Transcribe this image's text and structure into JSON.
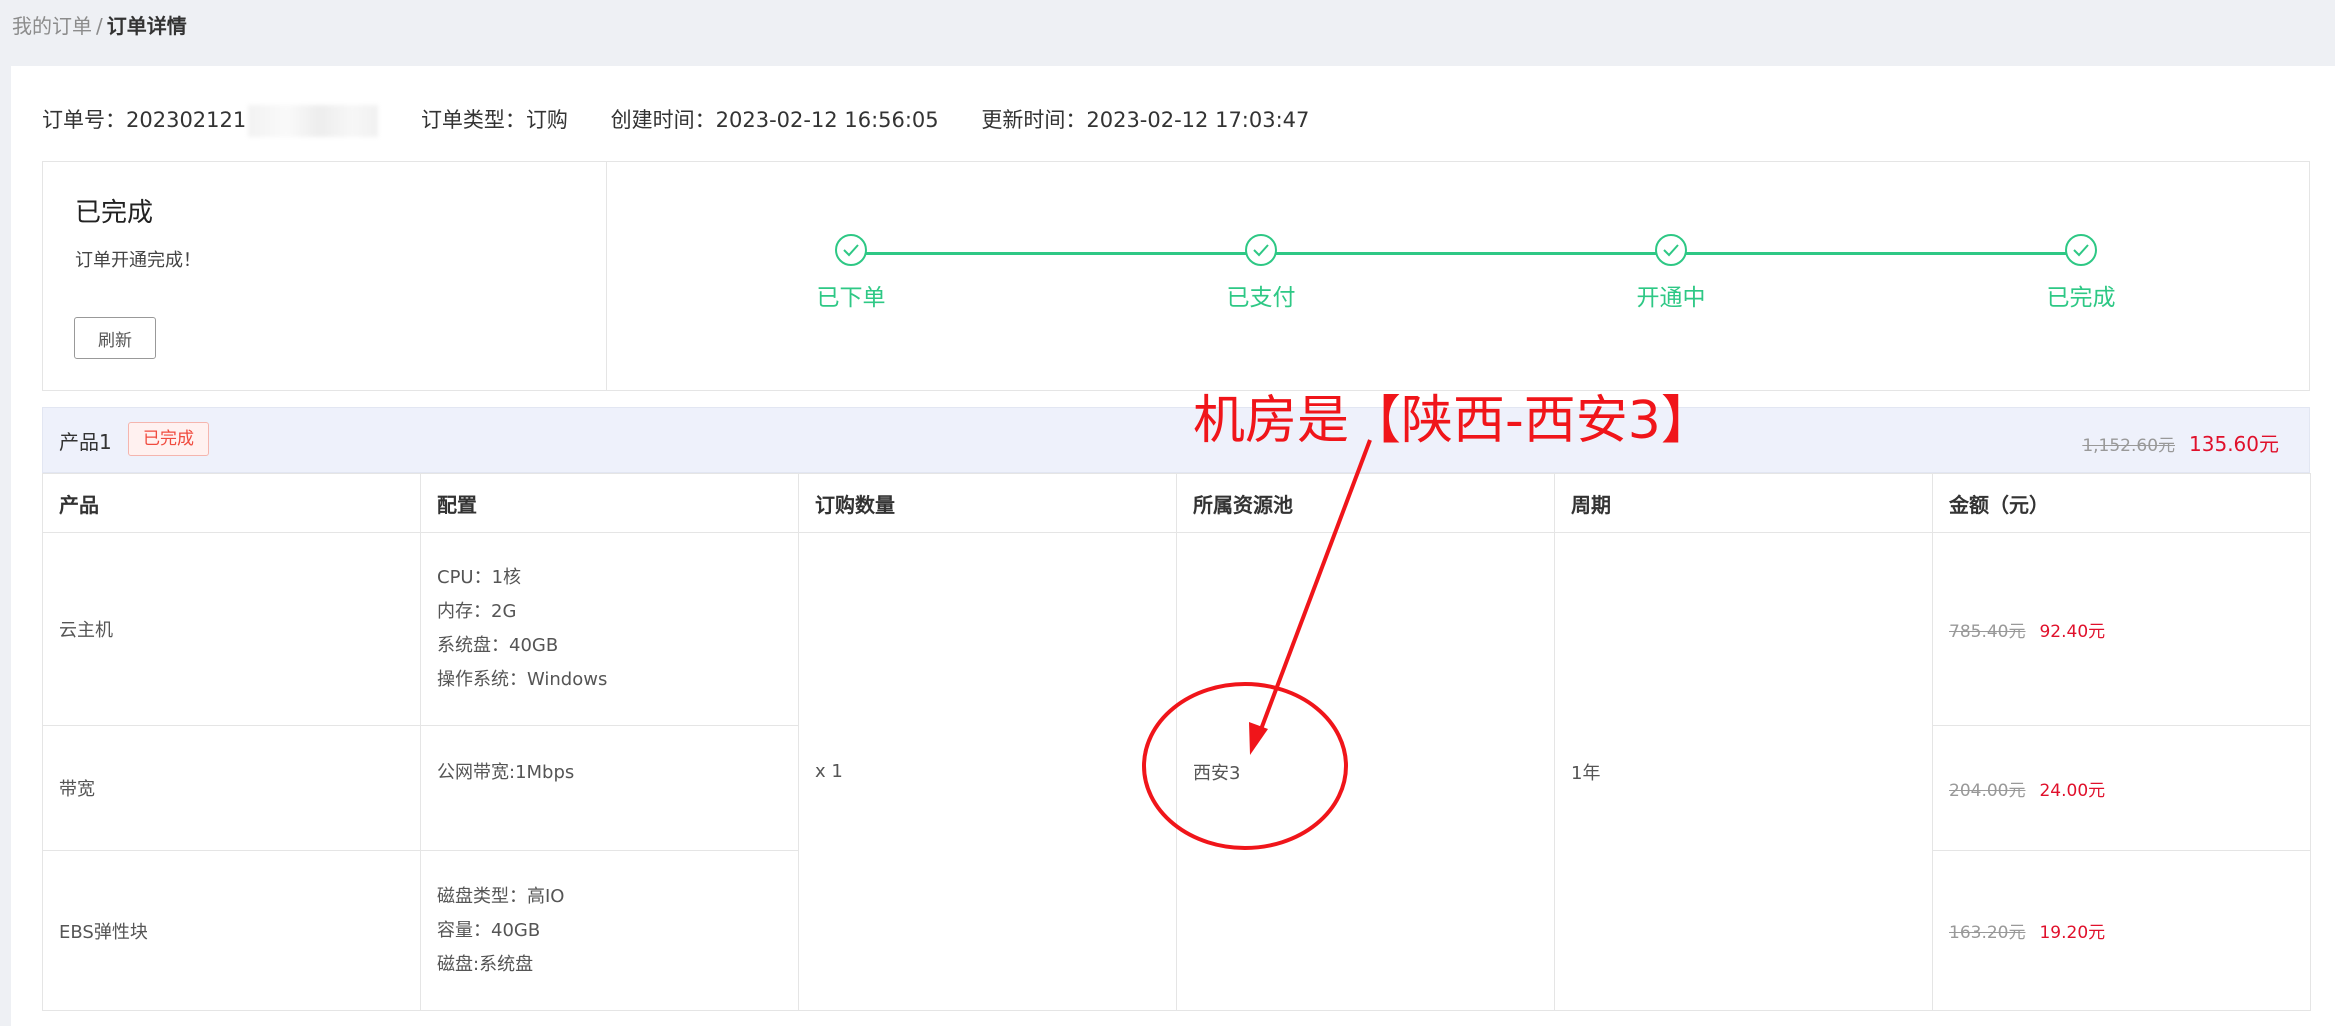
{
  "breadcrumb": {
    "parent": "我的订单",
    "separator": "/",
    "current": "订单详情"
  },
  "order": {
    "number_label": "订单号：",
    "number_value": "202302121",
    "type_label": "订单类型：",
    "type_value": "订购",
    "created_label": "创建时间：",
    "created_value": "2023-02-12 16:56:05",
    "updated_label": "更新时间：",
    "updated_value": "2023-02-12 17:03:47"
  },
  "status": {
    "title": "已完成",
    "description": "订单开通完成！",
    "refresh_label": "刷新",
    "steps": [
      "已下单",
      "已支付",
      "开通中",
      "已完成"
    ]
  },
  "product": {
    "name": "产品1",
    "badge": "已完成",
    "price_original": "1,152.60元",
    "price_final": "135.60元",
    "headers": [
      "产品",
      "配置",
      "订购数量",
      "所属资源池",
      "周期",
      "金额（元）"
    ],
    "quantity": "x 1",
    "pool": "西安3",
    "period": "1年",
    "rows": [
      {
        "name": "云主机",
        "config": [
          "CPU：1核",
          "内存：2G",
          "系统盘：40GB",
          "操作系统：Windows"
        ],
        "price_original": "785.40元",
        "price_final": "92.40元"
      },
      {
        "name": "带宽",
        "config": [
          "公网带宽:1Mbps"
        ],
        "price_original": "204.00元",
        "price_final": "24.00元"
      },
      {
        "name": "EBS弹性块",
        "config": [
          "磁盘类型：高IO",
          "容量：40GB",
          "磁盘:系统盘"
        ],
        "price_original": "163.20元",
        "price_final": "19.20元"
      }
    ]
  },
  "annotation": {
    "text": "机房是【陕西-西安3】",
    "color": "#f0151a"
  },
  "colors": {
    "success": "#2ec885",
    "price": "#e0102b",
    "badge": "#f04a3e"
  }
}
